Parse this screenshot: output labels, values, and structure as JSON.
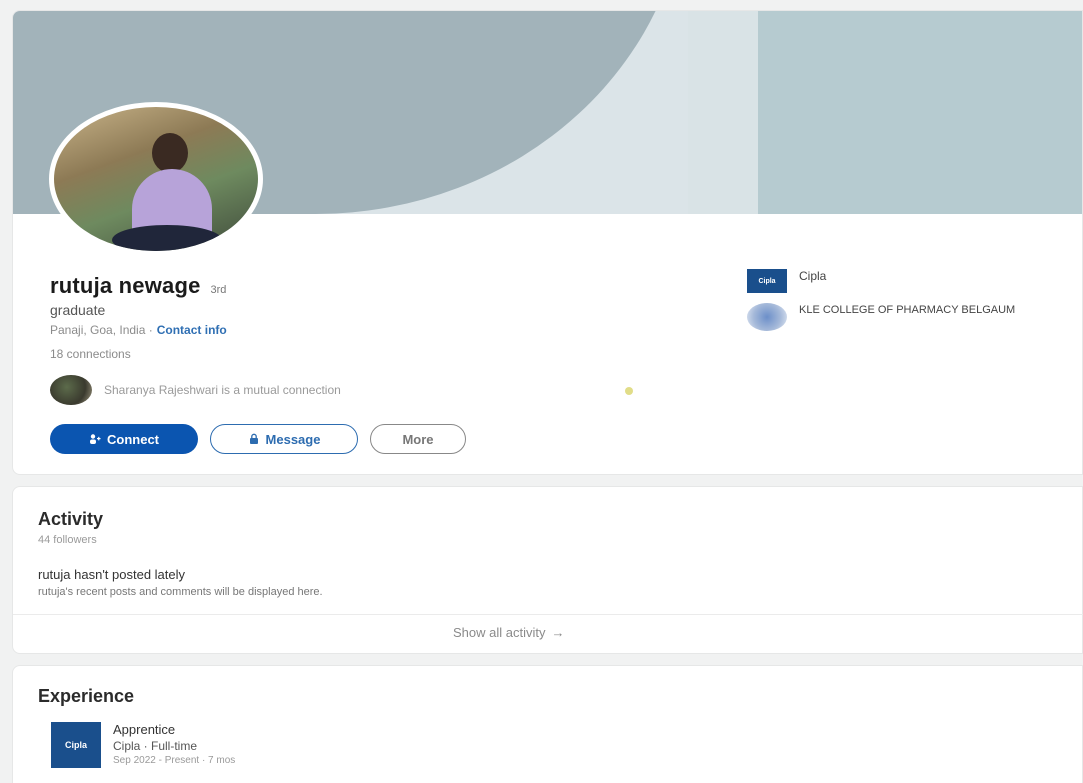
{
  "profile": {
    "name": "rutuja newage",
    "degree": "3rd",
    "headline": "graduate",
    "location": "Panaji, Goa, India ·",
    "contact_info": "Contact info",
    "connections": "18 connections",
    "mutual": "Sharanya Rajeshwari is a mutual connection"
  },
  "actions": {
    "connect": "Connect",
    "message": "Message",
    "more": "More"
  },
  "side": {
    "company": "Cipla",
    "company_logo_text": "Cipla",
    "college": "KLE COLLEGE OF PHARMACY BELGAUM"
  },
  "activity": {
    "title": "Activity",
    "followers": "44 followers",
    "not_posted": "rutuja hasn't posted lately",
    "not_posted_sub": "rutuja's recent posts and comments will be displayed here.",
    "show_all": "Show all activity",
    "show_all_arrow": "→"
  },
  "experience": {
    "title": "Experience",
    "items": [
      {
        "logo_text": "Cipla",
        "role": "Apprentice",
        "company": "Cipla · Full-time",
        "dates": "Sep 2022 - Present · 7 mos"
      }
    ]
  },
  "colors": {
    "accent": "#0b55b0",
    "link": "#2f6fb3",
    "cover_dark": "#a2b3ba",
    "cover_light": "#b6cbd0"
  }
}
